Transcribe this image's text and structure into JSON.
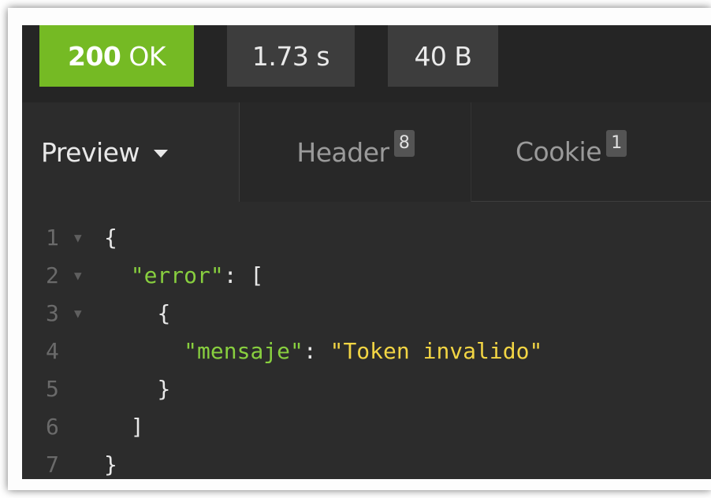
{
  "status": {
    "code": "200",
    "text": "OK",
    "time": "1.73 s",
    "size": "40 B"
  },
  "tabs": {
    "preview": "Preview",
    "header": "Header",
    "header_count": "8",
    "cookie": "Cookie",
    "cookie_count": "1"
  },
  "code": {
    "lines": [
      {
        "num": "1",
        "fold": true,
        "indent": "",
        "tokens": [
          {
            "t": "punc",
            "v": "{"
          }
        ]
      },
      {
        "num": "2",
        "fold": true,
        "indent": "  ",
        "tokens": [
          {
            "t": "key",
            "v": "\"error\""
          },
          {
            "t": "punc",
            "v": ": ["
          }
        ]
      },
      {
        "num": "3",
        "fold": true,
        "indent": "    ",
        "tokens": [
          {
            "t": "punc",
            "v": "{"
          }
        ]
      },
      {
        "num": "4",
        "fold": false,
        "indent": "      ",
        "tokens": [
          {
            "t": "key",
            "v": "\"mensaje\""
          },
          {
            "t": "punc",
            "v": ": "
          },
          {
            "t": "str",
            "v": "\"Token invalido\""
          }
        ]
      },
      {
        "num": "5",
        "fold": false,
        "indent": "    ",
        "tokens": [
          {
            "t": "punc",
            "v": "}"
          }
        ]
      },
      {
        "num": "6",
        "fold": false,
        "indent": "  ",
        "tokens": [
          {
            "t": "punc",
            "v": "]"
          }
        ]
      },
      {
        "num": "7",
        "fold": false,
        "indent": "",
        "tokens": [
          {
            "t": "punc",
            "v": "}"
          }
        ]
      }
    ]
  },
  "colors": {
    "status_ok": "#75ba24",
    "key": "#88cf3f",
    "string": "#f2d544",
    "background": "#2c2c2c"
  },
  "icons": {
    "preview_caret": "chevron-down-icon",
    "fold_marker": "fold-arrow-icon"
  }
}
